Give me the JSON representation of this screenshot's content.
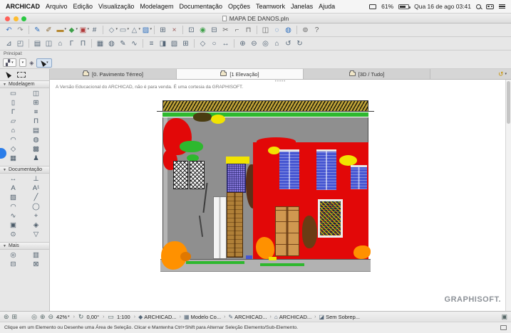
{
  "palette": {
    "accent_blue": "#2e6fbe",
    "facade_red": "#e20808",
    "facade_green": "#2eb82e",
    "facade_yellow": "#f2e400",
    "facade_orange": "#ff9100",
    "shutter_blue": "#4656d2",
    "wall_gray": "#8f8f8f",
    "hatch_gold": "#c2a43a",
    "door_tan": "#d09850",
    "dark_brown": "#5c3018"
  },
  "menubar": {
    "app_name": "ARCHICAD",
    "menus": [
      "Arquivo",
      "Edição",
      "Visualização",
      "Modelagem",
      "Documentação",
      "Opções",
      "Teamwork",
      "Janelas",
      "Ajuda"
    ],
    "battery": "61%",
    "datetime": "Qua 16 de ago 03:41"
  },
  "window": {
    "title": "MAPA DE DANOS.pln"
  },
  "toolbar_row1": [
    {
      "n": "undo-icon",
      "g": "↶",
      "c": "#3f74c4"
    },
    {
      "n": "redo-icon",
      "g": "↷",
      "c": "#8a8a8a"
    },
    {
      "sep": true
    },
    {
      "n": "pen-icon",
      "g": "✎",
      "c": "#2e6fbe"
    },
    {
      "n": "brush-icon",
      "g": "✐",
      "c": "#8a6a3a"
    },
    {
      "n": "wall-settings-icon",
      "g": "▬",
      "c": "#b5862e",
      "caret": true
    },
    {
      "n": "pen-set-icon",
      "g": "◆",
      "c": "#3fa04a",
      "caret": true
    },
    {
      "n": "fill-set-icon",
      "g": "▣",
      "c": "#b03a3a",
      "caret": true
    },
    {
      "n": "layer-icon",
      "g": "#",
      "c": "#556677"
    },
    {
      "sep": true
    },
    {
      "n": "guide-lines-icon",
      "g": "◇",
      "c": "#667788",
      "caret": true
    },
    {
      "n": "snap-guides-icon",
      "g": "▭",
      "c": "#667788",
      "caret": true
    },
    {
      "n": "gravity-icon",
      "g": "△",
      "c": "#667788",
      "caret": true
    },
    {
      "n": "magic-wand-icon",
      "g": "▨",
      "c": "#2e6fbe",
      "caret": true
    },
    {
      "sep": true
    },
    {
      "n": "grid-snap-icon",
      "g": "⊞",
      "c": "#556677"
    },
    {
      "n": "delete-icon",
      "g": "×",
      "c": "#995555"
    },
    {
      "sep": true
    },
    {
      "n": "group-icon",
      "g": "⊡",
      "c": "#556677"
    },
    {
      "n": "lock-icon",
      "g": "◉",
      "c": "#3fa04a"
    },
    {
      "n": "order-icon",
      "g": "⊟",
      "c": "#556677"
    },
    {
      "n": "split-icon",
      "g": "✂",
      "c": "#666666"
    },
    {
      "n": "adjust-icon",
      "g": "⌐",
      "c": "#666666"
    },
    {
      "n": "intersect-icon",
      "g": "⊓",
      "c": "#666666"
    },
    {
      "sep": true
    },
    {
      "n": "suspend-groups-icon",
      "g": "◫",
      "c": "#666666"
    },
    {
      "n": "pick-up-parameters-icon",
      "g": "◌",
      "c": "#2e6fbe"
    },
    {
      "n": "inject-parameters-icon",
      "g": "◍",
      "c": "#2e6fbe"
    },
    {
      "sep": true
    },
    {
      "n": "options-icon",
      "g": "⊚",
      "c": "#666666"
    },
    {
      "n": "help-icon",
      "g": "?",
      "c": "#666666"
    }
  ],
  "toolbar_row2": [
    {
      "n": "arrow-info-icon",
      "g": "⊿",
      "c": "#556677"
    },
    {
      "n": "marquee-info-icon",
      "g": "◰",
      "c": "#556677"
    },
    {
      "sep": true
    },
    {
      "n": "story-icon",
      "g": "▤",
      "c": "#556677"
    },
    {
      "n": "section-icon",
      "g": "◫",
      "c": "#556677"
    },
    {
      "n": "elevation-icon",
      "g": "⌂",
      "c": "#556677"
    },
    {
      "n": "detail-icon",
      "g": "Γ",
      "c": "#556677"
    },
    {
      "n": "worksheet-icon",
      "g": "Π",
      "c": "#556677"
    },
    {
      "sep": true
    },
    {
      "n": "layout-book-icon",
      "g": "▦",
      "c": "#556677"
    },
    {
      "n": "publisher-icon",
      "g": "◍",
      "c": "#556677"
    },
    {
      "n": "pen-sets-icon",
      "g": "✎",
      "c": "#556677"
    },
    {
      "n": "profile-manager-icon",
      "g": "∿",
      "c": "#556677"
    },
    {
      "sep": true
    },
    {
      "n": "layers-dialog-icon",
      "g": "≡",
      "c": "#556677"
    },
    {
      "n": "partial-display-icon",
      "g": "◨",
      "c": "#556677"
    },
    {
      "n": "renovation-icon",
      "g": "▧",
      "c": "#556677"
    },
    {
      "n": "grid-display-icon",
      "g": "⊞",
      "c": "#556677"
    },
    {
      "sep": true
    },
    {
      "n": "3d-view-icon",
      "g": "◇",
      "c": "#556677"
    },
    {
      "n": "camera-path-icon",
      "g": "○",
      "c": "#556677"
    },
    {
      "n": "fly-mode-icon",
      "g": "↔",
      "c": "#556677"
    },
    {
      "sep": true
    },
    {
      "n": "zoom-in-icon",
      "g": "⊕",
      "c": "#556677"
    },
    {
      "n": "zoom-out-icon",
      "g": "⊖",
      "c": "#556677"
    },
    {
      "n": "zoom-window-icon",
      "g": "◎",
      "c": "#556677"
    },
    {
      "n": "fit-in-window-icon",
      "g": "⌂",
      "c": "#556677"
    },
    {
      "n": "previous-zoom-icon",
      "g": "↺",
      "c": "#556677"
    },
    {
      "n": "next-zoom-icon",
      "g": "↻",
      "c": "#556677"
    }
  ],
  "principal": {
    "label": "Principal:"
  },
  "tabs": [
    {
      "label": "[0. Pavimento Térreo]",
      "active": false
    },
    {
      "label": "[1 Elevação]",
      "active": true
    },
    {
      "label": "[3D / Tudo]",
      "active": false
    }
  ],
  "toolbox": {
    "sections": [
      {
        "title": "Modelagem",
        "tools": [
          {
            "n": "wall-tool",
            "g": "▭"
          },
          {
            "n": "door-tool",
            "g": "◫"
          },
          {
            "n": "column-tool",
            "g": "▯"
          },
          {
            "n": "window-tool",
            "g": "⊞"
          },
          {
            "n": "beam-tool",
            "g": "Γ"
          },
          {
            "n": "stair-tool",
            "g": "≡"
          },
          {
            "n": "slab-tool",
            "g": "▱"
          },
          {
            "n": "railing-tool",
            "g": "Π"
          },
          {
            "n": "roof-tool",
            "g": "⌂"
          },
          {
            "n": "curtain-wall-tool",
            "g": "▤"
          },
          {
            "n": "shell-tool",
            "g": "◠"
          },
          {
            "n": "skylight-tool",
            "g": "◍"
          },
          {
            "n": "morph-tool",
            "g": "◇"
          },
          {
            "n": "zone-tool",
            "g": "▩"
          },
          {
            "n": "mesh-tool",
            "g": "▦"
          },
          {
            "n": "object-tool",
            "g": "♟"
          }
        ]
      },
      {
        "title": "Documentação",
        "tools": [
          {
            "n": "dimension-tool",
            "g": "↔"
          },
          {
            "n": "level-dimension-tool",
            "g": "⊥"
          },
          {
            "n": "text-tool",
            "g": "A"
          },
          {
            "n": "label-tool",
            "g": "A¹"
          },
          {
            "n": "fill-tool",
            "g": "▨"
          },
          {
            "n": "line-tool",
            "g": "╱"
          },
          {
            "n": "arc-tool",
            "g": "◠"
          },
          {
            "n": "circle-tool",
            "g": "◯"
          },
          {
            "n": "polyline-tool",
            "g": "∿"
          },
          {
            "n": "hotspot-tool",
            "g": "+"
          },
          {
            "n": "figure-tool",
            "g": "▣"
          },
          {
            "n": "drawing-tool",
            "g": "◈"
          },
          {
            "n": "camera-tool",
            "g": "⊙"
          },
          {
            "n": "marker-tool",
            "g": "▽"
          }
        ]
      },
      {
        "title": "Mais",
        "tools": [
          {
            "n": "detail-marker-tool",
            "g": "◎"
          },
          {
            "n": "worksheet-marker-tool",
            "g": "▥"
          },
          {
            "n": "section-marker-tool",
            "g": "⊟"
          },
          {
            "n": "elevation-marker-tool",
            "g": "⊠"
          }
        ]
      }
    ]
  },
  "canvas": {
    "edu_notice": "A Versão Educacional do ARCHICAD, não é para venda. É uma cortesia da GRAPHISOFT.",
    "watermark": "GRAPHISOFT."
  },
  "statusbar": {
    "zoom": "42%",
    "angle": "0,00°",
    "scale": "1:100",
    "breadcrumbs": [
      {
        "icon": "archicad-file-icon",
        "g": "◆",
        "label": "ARCHICAD..."
      },
      {
        "icon": "model-view-options-icon",
        "g": "▦",
        "label": "Modelo Co..."
      },
      {
        "icon": "pen-set-icon",
        "g": "✎",
        "label": "ARCHICAD..."
      },
      {
        "icon": "layer-combination-icon",
        "g": "⌂",
        "label": "ARCHICAD..."
      },
      {
        "icon": "overlay-filter-icon",
        "g": "◪",
        "label": "Sem Sobrep..."
      }
    ]
  },
  "hintbar": {
    "text": "Clique em um Elemento ou Desenhe uma Área de Seleção. Clicar e Mantenha Ctrl+Shift para Alternar Seleção Elemento/Sub-Elemento."
  }
}
